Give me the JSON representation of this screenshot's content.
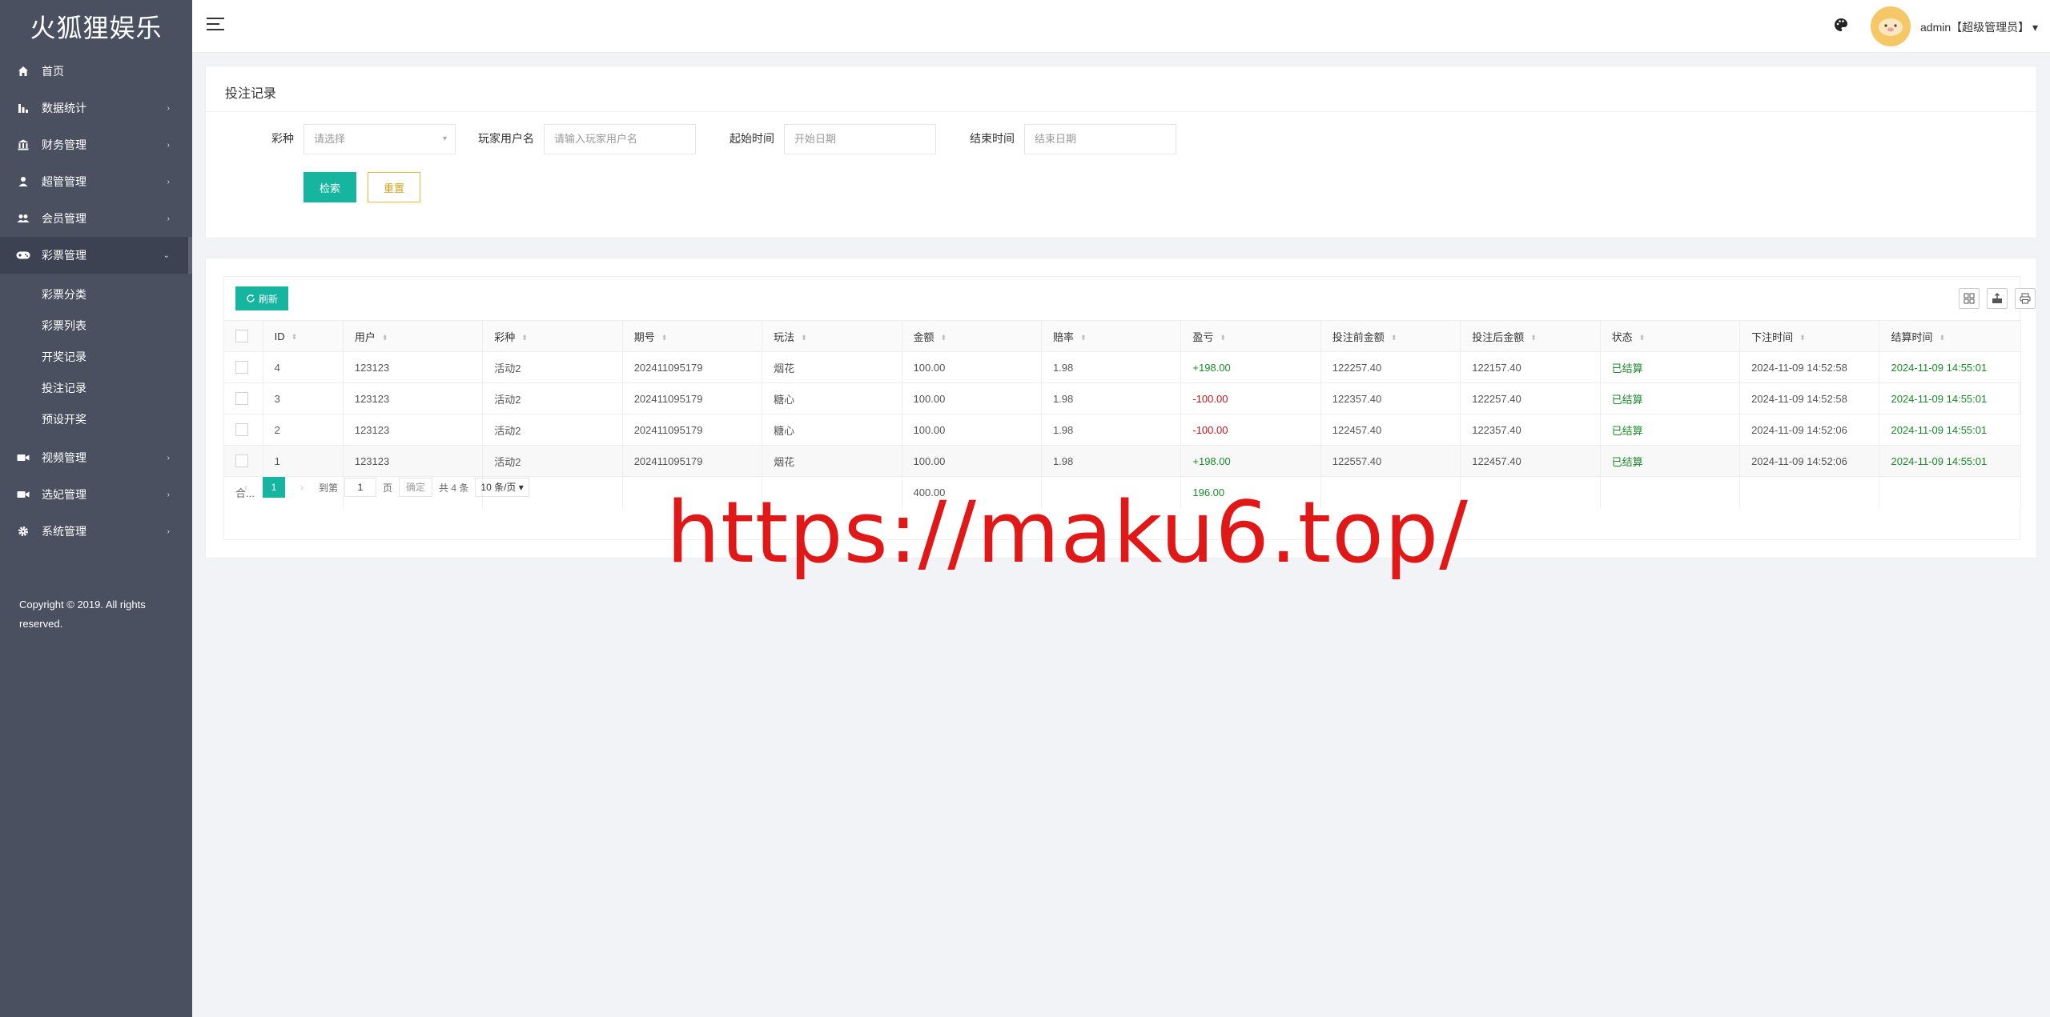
{
  "sidebar": {
    "logo": "火狐狸娱乐",
    "items": [
      {
        "label": "首页",
        "icon": "home-icon",
        "arrow": ""
      },
      {
        "label": "数据统计",
        "icon": "bar-chart-icon",
        "arrow": "›"
      },
      {
        "label": "财务管理",
        "icon": "bank-icon",
        "arrow": "›"
      },
      {
        "label": "超管管理",
        "icon": "user-icon",
        "arrow": "›"
      },
      {
        "label": "会员管理",
        "icon": "users-icon",
        "arrow": "›"
      },
      {
        "label": "彩票管理",
        "icon": "gamepad-icon",
        "arrow": "⌄"
      }
    ],
    "sub_items": [
      "彩票分类",
      "彩票列表",
      "开奖记录",
      "投注记录",
      "预设开奖"
    ],
    "items_after": [
      {
        "label": "视频管理",
        "icon": "video-icon",
        "arrow": "›"
      },
      {
        "label": "选妃管理",
        "icon": "video-icon",
        "arrow": "›"
      },
      {
        "label": "系统管理",
        "icon": "gear-icon",
        "arrow": "›"
      }
    ],
    "copyright": "Copyright © 2019. All rights reserved."
  },
  "header": {
    "user": "admin【超级管理员】",
    "user_caret": "▾"
  },
  "search": {
    "title": "投注记录",
    "fields": [
      {
        "label": "彩种",
        "placeholder": "请选择",
        "caret": "▾"
      },
      {
        "label": "玩家用户名",
        "placeholder": "请输入玩家用户名",
        "caret": ""
      },
      {
        "label": "起始时间",
        "placeholder": "开始日期",
        "caret": ""
      },
      {
        "label": "结束时间",
        "placeholder": "结束日期",
        "caret": ""
      }
    ],
    "search_label": "检索",
    "reset_label": "重置"
  },
  "table": {
    "refresh_label": "刷新",
    "sort_glyph": "⬍",
    "columns": [
      "ID",
      "用户",
      "彩种",
      "期号",
      "玩法",
      "金额",
      "赔率",
      "盈亏",
      "投注前金额",
      "投注后金额",
      "状态",
      "下注时间",
      "结算时间"
    ],
    "rows": [
      {
        "id": "4",
        "user": "123123",
        "lottery": "活动2",
        "issue": "202411095179",
        "play": "烟花",
        "amount": "100.00",
        "odds": "1.98",
        "profit": "+198.00",
        "before": "122257.40",
        "after": "122157.40",
        "status": "已结算",
        "bet_time": "2024-11-09 14:52:58",
        "settle_time": "2024-11-09 14:55:01"
      },
      {
        "id": "3",
        "user": "123123",
        "lottery": "活动2",
        "issue": "202411095179",
        "play": "糖心",
        "amount": "100.00",
        "odds": "1.98",
        "profit": "-100.00",
        "before": "122357.40",
        "after": "122257.40",
        "status": "已结算",
        "bet_time": "2024-11-09 14:52:58",
        "settle_time": "2024-11-09 14:55:01"
      },
      {
        "id": "2",
        "user": "123123",
        "lottery": "活动2",
        "issue": "202411095179",
        "play": "糖心",
        "amount": "100.00",
        "odds": "1.98",
        "profit": "-100.00",
        "before": "122457.40",
        "after": "122357.40",
        "status": "已结算",
        "bet_time": "2024-11-09 14:52:06",
        "settle_time": "2024-11-09 14:55:01"
      },
      {
        "id": "1",
        "user": "123123",
        "lottery": "活动2",
        "issue": "202411095179",
        "play": "烟花",
        "amount": "100.00",
        "odds": "1.98",
        "profit": "+198.00",
        "before": "122557.40",
        "after": "122457.40",
        "status": "已结算",
        "bet_time": "2024-11-09 14:52:06",
        "settle_time": "2024-11-09 14:55:01"
      }
    ],
    "total": {
      "label": "合...",
      "amount": "400.00",
      "profit": "196.00"
    }
  },
  "pager": {
    "prev": "‹",
    "current_page": "1",
    "next": "›",
    "goto_label": "到第",
    "goto_value": "1",
    "page_unit": "页",
    "confirm": "确定",
    "total": "共 4 条",
    "page_size": "10 条/页 ▾"
  },
  "watermark": "https://maku6.top/",
  "colors": {
    "accent": "#16b5a0",
    "sidebar": "#4a5060",
    "profit_positive": "#1a8a2a",
    "profit_negative": "#c5161d",
    "reset_border": "#e9b934"
  }
}
